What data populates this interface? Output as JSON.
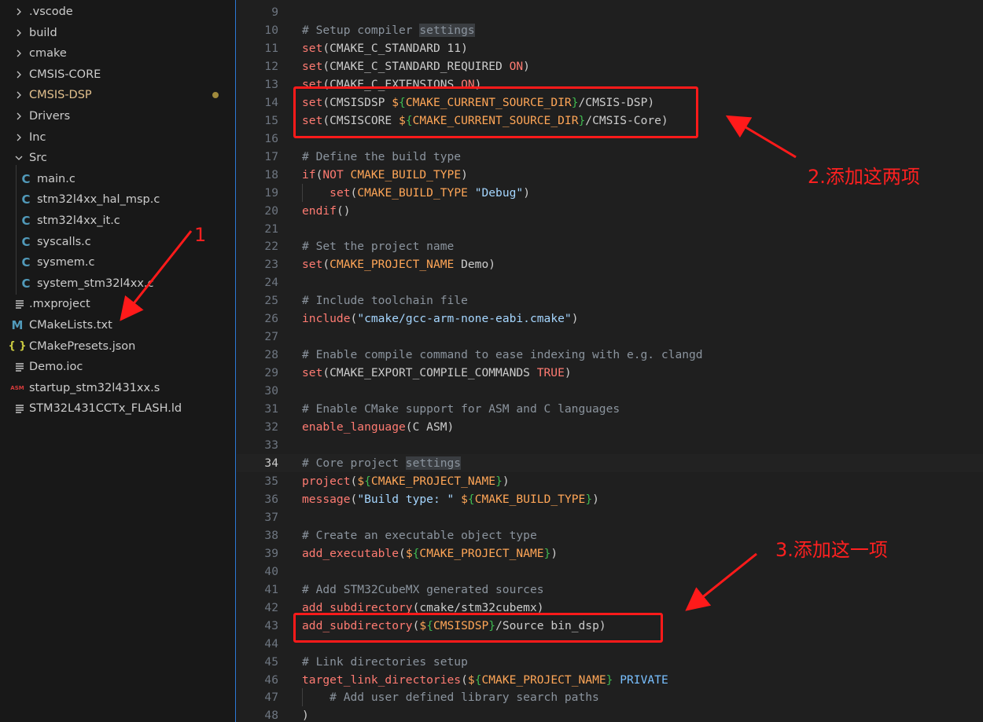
{
  "explorer": {
    "items": [
      {
        "type": "folder",
        "label": ".vscode"
      },
      {
        "type": "folder",
        "label": "build"
      },
      {
        "type": "folder",
        "label": "cmake"
      },
      {
        "type": "folder",
        "label": "CMSIS-CORE"
      },
      {
        "type": "folder",
        "label": "CMSIS-DSP",
        "modified": true
      },
      {
        "type": "folder",
        "label": "Drivers"
      },
      {
        "type": "folder",
        "label": "Inc"
      },
      {
        "type": "folder-open",
        "label": "Src"
      },
      {
        "type": "c-file",
        "label": "main.c",
        "icon": "c-file-icon"
      },
      {
        "type": "c-file",
        "label": "stm32l4xx_hal_msp.c",
        "icon": "c-file-icon"
      },
      {
        "type": "c-file",
        "label": "stm32l4xx_it.c",
        "icon": "c-file-icon"
      },
      {
        "type": "c-file",
        "label": "syscalls.c",
        "icon": "c-file-icon"
      },
      {
        "type": "c-file",
        "label": "sysmem.c",
        "icon": "c-file-icon"
      },
      {
        "type": "c-file",
        "label": "system_stm32l4xx.c",
        "icon": "c-file-icon"
      },
      {
        "type": "file",
        "label": ".mxproject",
        "icon": "lines-file-icon"
      },
      {
        "type": "file",
        "label": "CMakeLists.txt",
        "icon": "cmake-file-icon"
      },
      {
        "type": "file",
        "label": "CMakePresets.json",
        "icon": "json-file-icon"
      },
      {
        "type": "file",
        "label": "Demo.ioc",
        "icon": "lines-file-icon"
      },
      {
        "type": "file",
        "label": "startup_stm32l431xx.s",
        "icon": "asm-file-icon"
      },
      {
        "type": "file",
        "label": "STM32L431CCTx_FLASH.ld",
        "icon": "lines-file-icon"
      }
    ],
    "icon_glyphs": {
      "c": "C",
      "cmake": "M",
      "json": "{ }",
      "asm": "ASM"
    }
  },
  "editor": {
    "current_line": "34",
    "lines": [
      {
        "n": "9",
        "code": ""
      },
      {
        "n": "10",
        "code": "# Setup compiler settings"
      },
      {
        "n": "11",
        "code": "set(CMAKE_C_STANDARD 11)"
      },
      {
        "n": "12",
        "code": "set(CMAKE_C_STANDARD_REQUIRED ON)"
      },
      {
        "n": "13",
        "code": "set(CMAKE_C_EXTENSIONS ON)"
      },
      {
        "n": "14",
        "code": "set(CMSISDSP ${CMAKE_CURRENT_SOURCE_DIR}/CMSIS-DSP)"
      },
      {
        "n": "15",
        "code": "set(CMSISCORE ${CMAKE_CURRENT_SOURCE_DIR}/CMSIS-Core)"
      },
      {
        "n": "16",
        "code": ""
      },
      {
        "n": "17",
        "code": "# Define the build type"
      },
      {
        "n": "18",
        "code": "if(NOT CMAKE_BUILD_TYPE)"
      },
      {
        "n": "19",
        "code": "    set(CMAKE_BUILD_TYPE \"Debug\")"
      },
      {
        "n": "20",
        "code": "endif()"
      },
      {
        "n": "21",
        "code": ""
      },
      {
        "n": "22",
        "code": "# Set the project name"
      },
      {
        "n": "23",
        "code": "set(CMAKE_PROJECT_NAME Demo)"
      },
      {
        "n": "24",
        "code": ""
      },
      {
        "n": "25",
        "code": "# Include toolchain file"
      },
      {
        "n": "26",
        "code": "include(\"cmake/gcc-arm-none-eabi.cmake\")"
      },
      {
        "n": "27",
        "code": ""
      },
      {
        "n": "28",
        "code": "# Enable compile command to ease indexing with e.g. clangd"
      },
      {
        "n": "29",
        "code": "set(CMAKE_EXPORT_COMPILE_COMMANDS TRUE)"
      },
      {
        "n": "30",
        "code": ""
      },
      {
        "n": "31",
        "code": "# Enable CMake support for ASM and C languages"
      },
      {
        "n": "32",
        "code": "enable_language(C ASM)"
      },
      {
        "n": "33",
        "code": ""
      },
      {
        "n": "34",
        "code": "# Core project settings"
      },
      {
        "n": "35",
        "code": "project(${CMAKE_PROJECT_NAME})"
      },
      {
        "n": "36",
        "code": "message(\"Build type: \" ${CMAKE_BUILD_TYPE})"
      },
      {
        "n": "37",
        "code": ""
      },
      {
        "n": "38",
        "code": "# Create an executable object type"
      },
      {
        "n": "39",
        "code": "add_executable(${CMAKE_PROJECT_NAME})"
      },
      {
        "n": "40",
        "code": ""
      },
      {
        "n": "41",
        "code": "# Add STM32CubeMX generated sources"
      },
      {
        "n": "42",
        "code": "add_subdirectory(cmake/stm32cubemx)"
      },
      {
        "n": "43",
        "code": "add_subdirectory(${CMSISDSP}/Source bin_dsp)"
      },
      {
        "n": "44",
        "code": ""
      },
      {
        "n": "45",
        "code": "# Link directories setup"
      },
      {
        "n": "46",
        "code": "target_link_directories(${CMAKE_PROJECT_NAME} PRIVATE"
      },
      {
        "n": "47",
        "code": "    # Add user defined library search paths"
      },
      {
        "n": "48",
        "code": ")"
      }
    ]
  },
  "annotations": {
    "label1": "1",
    "label2": "2.添加这两项",
    "label3": "3.添加这一项",
    "color": "#ff1a1a"
  }
}
